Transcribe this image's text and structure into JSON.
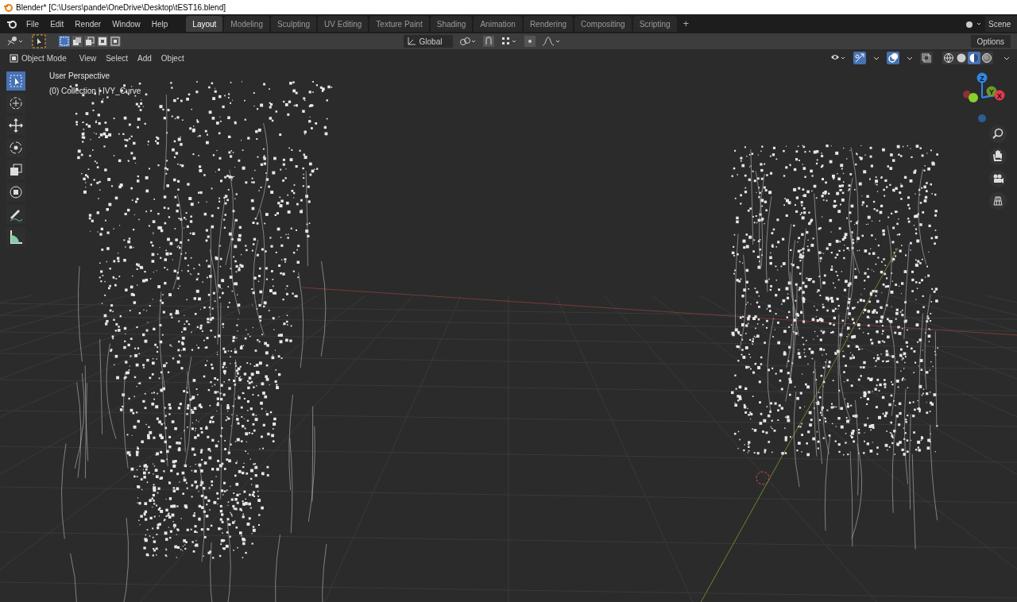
{
  "window": {
    "title": "Blender* [C:\\Users\\pande\\OneDrive\\Desktop\\tEST16.blend]"
  },
  "menu": [
    "File",
    "Edit",
    "Render",
    "Window",
    "Help"
  ],
  "workspaces": [
    {
      "label": "Layout",
      "selected": true
    },
    {
      "label": "Modeling",
      "selected": false
    },
    {
      "label": "Sculpting",
      "selected": false
    },
    {
      "label": "UV Editing",
      "selected": false
    },
    {
      "label": "Texture Paint",
      "selected": false
    },
    {
      "label": "Shading",
      "selected": false
    },
    {
      "label": "Animation",
      "selected": false
    },
    {
      "label": "Rendering",
      "selected": false
    },
    {
      "label": "Compositing",
      "selected": false
    },
    {
      "label": "Scripting",
      "selected": false
    }
  ],
  "add_workspace": "+",
  "scene": "Scene",
  "tool_header": {
    "orientation": "Global",
    "options": "Options"
  },
  "viewport_header": {
    "mode": "Object Mode",
    "menus": [
      "View",
      "Select",
      "Add",
      "Object"
    ],
    "toggles": [
      {
        "kind": "gizmo",
        "on": true
      },
      {
        "kind": "overlay",
        "on": true
      },
      {
        "kind": "xray",
        "on": false
      }
    ],
    "shading": [
      {
        "kind": "wireframe",
        "selected": false
      },
      {
        "kind": "solid",
        "selected": false
      },
      {
        "kind": "material",
        "selected": true
      },
      {
        "kind": "rendered",
        "selected": false
      }
    ]
  },
  "overlay_text": [
    "User Perspective",
    "(0) Collection | IVY_Curve"
  ],
  "tools": [
    {
      "kind": "select",
      "selected": true
    },
    {
      "kind": "cursor",
      "selected": false
    },
    {
      "kind": "move",
      "selected": false
    },
    {
      "kind": "rotate",
      "selected": false
    },
    {
      "kind": "scale",
      "selected": false
    },
    {
      "kind": "transform",
      "selected": false
    },
    {
      "kind": "annotate",
      "selected": false
    },
    {
      "kind": "measure",
      "selected": false
    }
  ],
  "axes": [
    "Z",
    "Y",
    "X"
  ]
}
